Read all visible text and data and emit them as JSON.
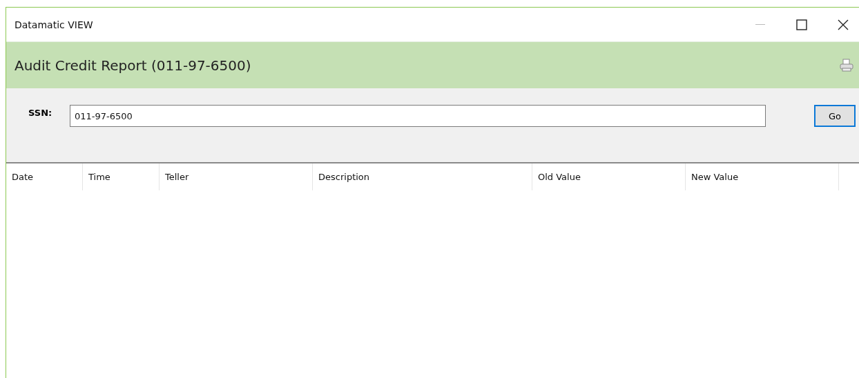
{
  "window": {
    "title": "Datamatic VIEW"
  },
  "header": {
    "title": "Audit Credit Report (011-97-6500)"
  },
  "form": {
    "label": "SSN:",
    "value": "011-97-6500",
    "button": "Go"
  },
  "table": {
    "columns": [
      "Date",
      "Time",
      "Teller",
      "Description",
      "Old Value",
      "New Value"
    ]
  }
}
